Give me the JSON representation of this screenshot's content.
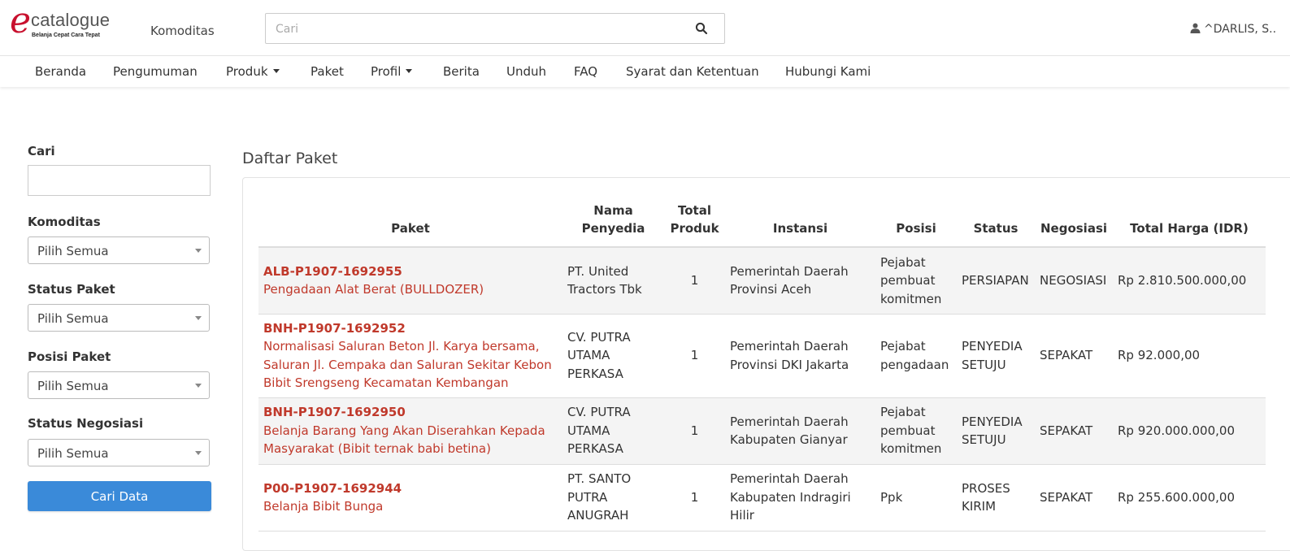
{
  "header": {
    "logo_mark": "e",
    "logo_text": "catalogue",
    "logo_tagline": "Belanja Cepat Cara Tepat",
    "komoditas_link": "Komoditas",
    "search_placeholder": "Cari",
    "user_name": "^DARLIS, S.."
  },
  "nav": {
    "items": [
      {
        "label": "Beranda"
      },
      {
        "label": "Pengumuman"
      },
      {
        "label": "Produk",
        "dropdown": true
      },
      {
        "label": "Paket"
      },
      {
        "label": "Profil",
        "dropdown": true
      },
      {
        "label": "Berita"
      },
      {
        "label": "Unduh"
      },
      {
        "label": "FAQ"
      },
      {
        "label": "Syarat dan Ketentuan"
      },
      {
        "label": "Hubungi Kami"
      }
    ]
  },
  "sidebar": {
    "cari_label": "Cari",
    "cari_value": "",
    "filters": [
      {
        "label": "Komoditas",
        "value": "Pilih Semua"
      },
      {
        "label": "Status Paket",
        "value": "Pilih Semua"
      },
      {
        "label": "Posisi Paket",
        "value": "Pilih Semua"
      },
      {
        "label": "Status Negosiasi",
        "value": "Pilih Semua"
      }
    ],
    "button_label": "Cari Data"
  },
  "main": {
    "title": "Daftar Paket",
    "columns": [
      "Paket",
      "Nama Penyedia",
      "Total Produk",
      "Instansi",
      "Posisi",
      "Status",
      "Negosiasi",
      "Total Harga (IDR)"
    ],
    "rows": [
      {
        "code": "ALB-P1907-1692955",
        "name": "Pengadaan Alat Berat (BULLDOZER)",
        "penyedia": "PT. United Tractors Tbk",
        "total_produk": "1",
        "instansi": "Pemerintah Daerah Provinsi Aceh",
        "posisi": "Pejabat pembuat komitmen",
        "status": "PERSIAPAN",
        "negosiasi": "NEGOSIASI",
        "harga": "Rp 2.810.500.000,00"
      },
      {
        "code": "BNH-P1907-1692952",
        "name": "Normalisasi Saluran Beton Jl. Karya bersama, Saluran Jl. Cempaka dan Saluran Sekitar Kebon Bibit Srengseng Kecamatan Kembangan",
        "penyedia": "CV. PUTRA UTAMA PERKASA",
        "total_produk": "1",
        "instansi": "Pemerintah Daerah Provinsi DKI Jakarta",
        "posisi": "Pejabat pengadaan",
        "status": "PENYEDIA SETUJU",
        "negosiasi": "SEPAKAT",
        "harga": "Rp 92.000,00"
      },
      {
        "code": "BNH-P1907-1692950",
        "name": "Belanja Barang Yang Akan Diserahkan Kepada Masyarakat (Bibit ternak babi betina)",
        "penyedia": "CV. PUTRA UTAMA PERKASA",
        "total_produk": "1",
        "instansi": "Pemerintah Daerah Kabupaten Gianyar",
        "posisi": "Pejabat pembuat komitmen",
        "status": "PENYEDIA SETUJU",
        "negosiasi": "SEPAKAT",
        "harga": "Rp 920.000.000,00"
      },
      {
        "code": "P00-P1907-1692944",
        "name": "Belanja Bibit Bunga",
        "penyedia": "PT. SANTO PUTRA ANUGRAH",
        "total_produk": "1",
        "instansi": "Pemerintah Daerah Kabupaten Indragiri Hilir",
        "posisi": "Ppk",
        "status": "PROSES KIRIM",
        "negosiasi": "SEPAKAT",
        "harga": "Rp 255.600.000,00"
      }
    ]
  },
  "colors": {
    "accent_red": "#c0392b",
    "button_blue": "#3a8ad9"
  },
  "icons": {
    "search": "search-icon",
    "user": "user-icon"
  }
}
